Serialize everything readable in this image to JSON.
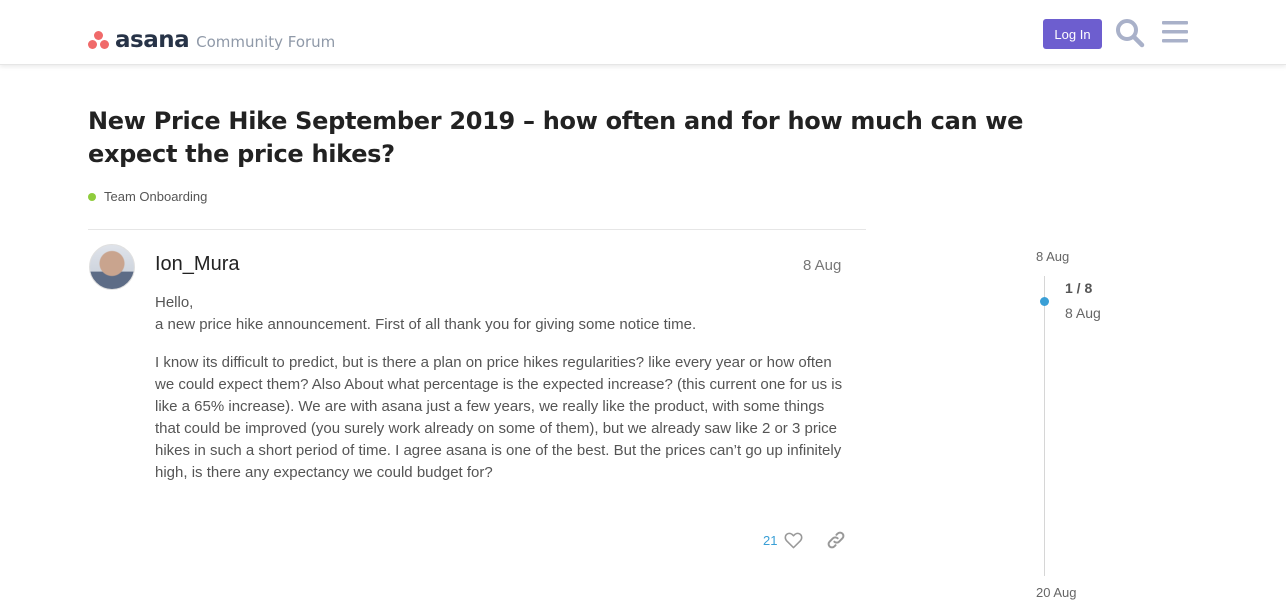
{
  "header": {
    "brand": "asana",
    "forum_name": "Community Forum",
    "login_label": "Log In",
    "search_icon": "search-icon",
    "menu_icon": "hamburger-menu-icon"
  },
  "topic": {
    "title": "New Price Hike September 2019 – how often and for how much can we expect the price hikes?",
    "category": "Team Onboarding",
    "category_color": "#8fcc3c"
  },
  "post": {
    "username": "Ion_Mura",
    "date": "8 Aug",
    "paragraphs": [
      "Hello,\na new price hike announcement. First of all thank you for giving some notice time.",
      "I know its difficult to predict, but is there a plan on price hikes regularities? like every year or how often we could expect them? Also About what percentage is the expected increase? (this current one for us is like a 65% increase). We are with asana just a few years, we really like the product, with some things that could be improved (you surely work already on some of them), but we already saw like 2 or 3 price hikes in such a short period of time. I agree asana is one of the best. But the prices can’t go up infinitely high, is there any expectancy we could budget for?"
    ],
    "likes": "21"
  },
  "timeline": {
    "start_date": "8 Aug",
    "position": "1 / 8",
    "current_date": "8 Aug",
    "end_date": "20 Aug"
  },
  "colors": {
    "accent": "#6d5ecf",
    "brand_logo": "#f06a6a",
    "link": "#3a9fd6"
  }
}
